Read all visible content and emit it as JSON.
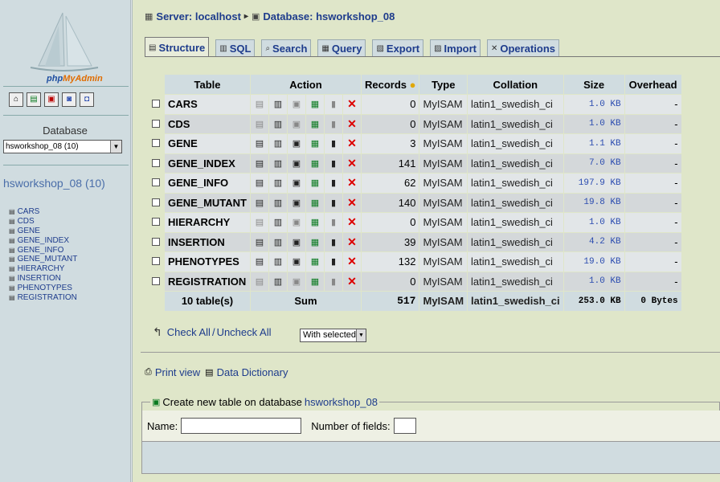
{
  "sidebar": {
    "logo": {
      "part1": "php",
      "part2": "MyAdmin"
    },
    "icons": [
      "home-icon",
      "sql-query-icon",
      "sql-window-icon",
      "docs-icon",
      "docs2-icon"
    ],
    "database_label": "Database",
    "database_select": "hsworkshop_08 (10)",
    "db_title": "hsworkshop_08 (10)",
    "tables": [
      "CARS",
      "CDS",
      "GENE",
      "GENE_INDEX",
      "GENE_INFO",
      "GENE_MUTANT",
      "HIERARCHY",
      "INSERTION",
      "PHENOTYPES",
      "REGISTRATION"
    ]
  },
  "breadcrumb": {
    "server": "Server: localhost",
    "sep": "▸",
    "database": "Database: hsworkshop_08"
  },
  "tabs": [
    {
      "label": "Structure",
      "icon": "structure-icon",
      "active": true
    },
    {
      "label": "SQL",
      "icon": "sql-icon",
      "active": false
    },
    {
      "label": "Search",
      "icon": "search-icon",
      "active": false
    },
    {
      "label": "Query",
      "icon": "query-icon",
      "active": false
    },
    {
      "label": "Export",
      "icon": "export-icon",
      "active": false
    },
    {
      "label": "Import",
      "icon": "import-icon",
      "active": false
    },
    {
      "label": "Operations",
      "icon": "operations-icon",
      "active": false
    }
  ],
  "table": {
    "headers": {
      "table": "Table",
      "action": "Action",
      "records": "Records",
      "type": "Type",
      "collation": "Collation",
      "size": "Size",
      "overhead": "Overhead"
    },
    "rows": [
      {
        "name": "CARS",
        "records": "0",
        "type": "MyISAM",
        "collation": "latin1_swedish_ci",
        "size": "1.0 KB",
        "overhead": "-"
      },
      {
        "name": "CDS",
        "records": "0",
        "type": "MyISAM",
        "collation": "latin1_swedish_ci",
        "size": "1.0 KB",
        "overhead": "-"
      },
      {
        "name": "GENE",
        "records": "3",
        "type": "MyISAM",
        "collation": "latin1_swedish_ci",
        "size": "1.1 KB",
        "overhead": "-"
      },
      {
        "name": "GENE_INDEX",
        "records": "141",
        "type": "MyISAM",
        "collation": "latin1_swedish_ci",
        "size": "7.0 KB",
        "overhead": "-"
      },
      {
        "name": "GENE_INFO",
        "records": "62",
        "type": "MyISAM",
        "collation": "latin1_swedish_ci",
        "size": "197.9 KB",
        "overhead": "-"
      },
      {
        "name": "GENE_MUTANT",
        "records": "140",
        "type": "MyISAM",
        "collation": "latin1_swedish_ci",
        "size": "19.8 KB",
        "overhead": "-"
      },
      {
        "name": "HIERARCHY",
        "records": "0",
        "type": "MyISAM",
        "collation": "latin1_swedish_ci",
        "size": "1.0 KB",
        "overhead": "-"
      },
      {
        "name": "INSERTION",
        "records": "39",
        "type": "MyISAM",
        "collation": "latin1_swedish_ci",
        "size": "4.2 KB",
        "overhead": "-"
      },
      {
        "name": "PHENOTYPES",
        "records": "132",
        "type": "MyISAM",
        "collation": "latin1_swedish_ci",
        "size": "19.0 KB",
        "overhead": "-"
      },
      {
        "name": "REGISTRATION",
        "records": "0",
        "type": "MyISAM",
        "collation": "latin1_swedish_ci",
        "size": "1.0 KB",
        "overhead": "-"
      }
    ],
    "footer": {
      "count": "10 table(s)",
      "sum": "Sum",
      "records": "517",
      "type": "MyISAM",
      "collation": "latin1_swedish_ci",
      "size": "253.0 KB",
      "overhead": "0 Bytes"
    }
  },
  "bulk": {
    "check_all": "Check All",
    "slash": "/",
    "uncheck_all": "Uncheck All",
    "with_selected": "With selected:"
  },
  "links": {
    "print_view": "Print view",
    "data_dictionary": "Data Dictionary"
  },
  "create_table": {
    "legend": "Create new table on database",
    "database": "hsworkshop_08",
    "name_label": "Name:",
    "fields_label": "Number of fields:"
  },
  "colors": {
    "page_bg": "#dfe6c9",
    "sidebar_bg": "#d0dce0",
    "link": "#1e3c8c",
    "drop_x": "#dd0000",
    "size_text": "#2b4cb0"
  }
}
